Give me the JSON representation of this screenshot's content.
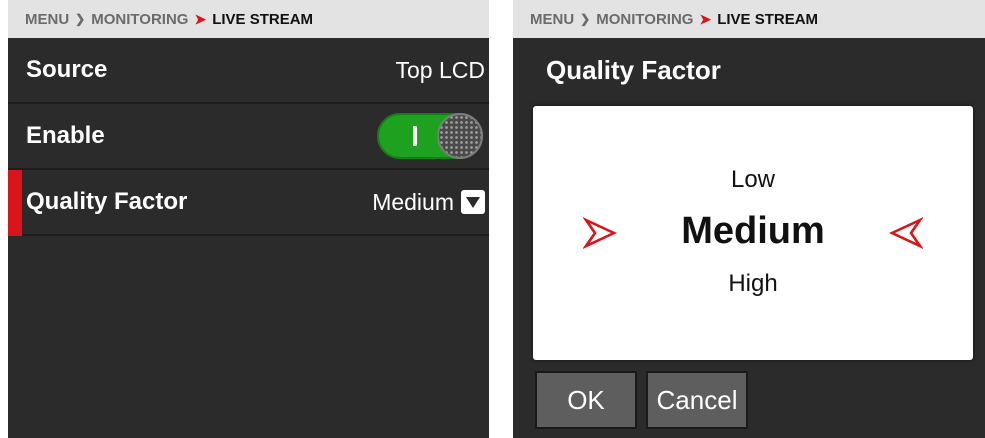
{
  "left": {
    "breadcrumb": {
      "root": "MENU",
      "section": "MONITORING",
      "current": "LIVE STREAM"
    },
    "rows": [
      {
        "label": "Source",
        "value": "Top LCD"
      },
      {
        "label": "Enable",
        "toggle_state": "on"
      },
      {
        "label": "Quality Factor",
        "value": "Medium",
        "selected": true
      }
    ]
  },
  "right": {
    "breadcrumb": {
      "root": "MENU",
      "section": "MONITORING",
      "current": "LIVE STREAM"
    },
    "dialog": {
      "title": "Quality Factor",
      "options": {
        "previous": "Low",
        "current": "Medium",
        "next": "High"
      },
      "ok_label": "OK",
      "cancel_label": "Cancel"
    }
  },
  "colors": {
    "accent_red": "#d9141b",
    "toggle_green": "#1ea11e",
    "panel_bg": "#2b2b2b",
    "breadcrumb_bg": "#e3e3e3"
  },
  "icons": {
    "breadcrumb_separator": "chevron-right-icon",
    "active_separator": "red-arrow-icon",
    "dropdown": "dropdown-triangle-icon",
    "picker_left": "red-arrow-right-icon",
    "picker_right": "red-arrow-left-icon"
  }
}
